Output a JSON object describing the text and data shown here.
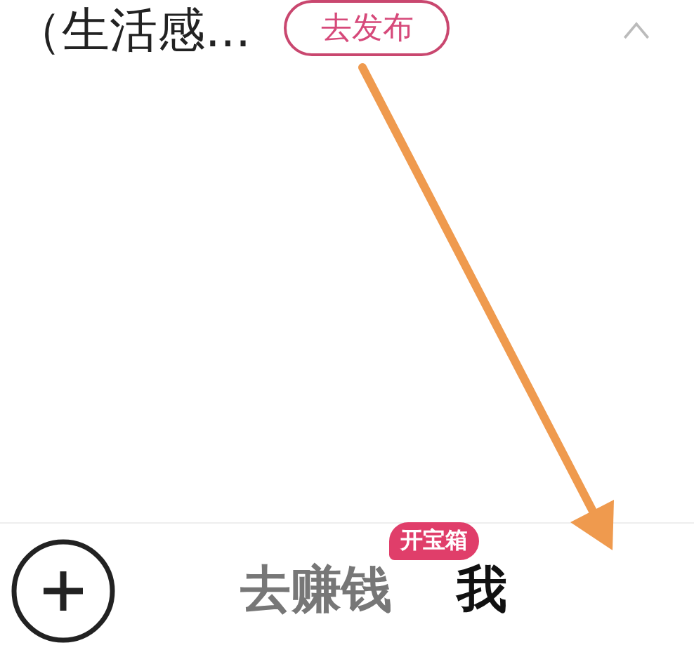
{
  "top_bar": {
    "title": "（生活感...",
    "publish_button": "去发布"
  },
  "tab_bar": [
    {
      "kind": "add"
    },
    {
      "kind": "tab",
      "label": "去赚钱",
      "selected": false,
      "badge": "开宝箱"
    },
    {
      "kind": "tab",
      "label": "我",
      "selected": true
    }
  ]
}
